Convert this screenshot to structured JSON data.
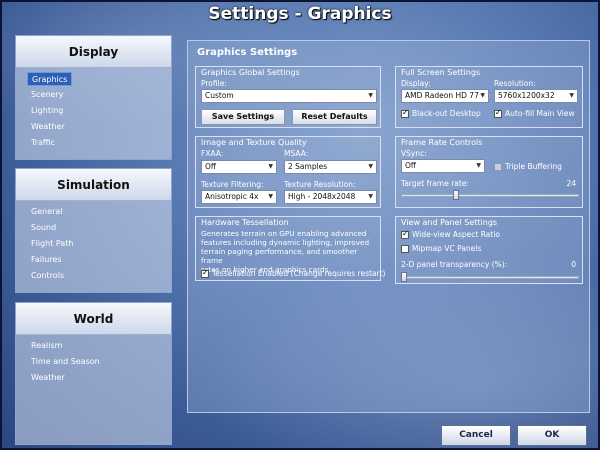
{
  "window": {
    "title": "Settings - Graphics"
  },
  "sidebar": {
    "display": {
      "title": "Display",
      "items": [
        "Graphics",
        "Scenery",
        "Lighting",
        "Weather",
        "Traffic"
      ]
    },
    "simulation": {
      "title": "Simulation",
      "items": [
        "General",
        "Sound",
        "Flight Path",
        "Failures",
        "Controls"
      ]
    },
    "world": {
      "title": "World",
      "items": [
        "Realism",
        "Time and Season",
        "Weather"
      ]
    }
  },
  "main": {
    "title": "Graphics Settings",
    "global": {
      "title": "Graphics Global Settings",
      "profile_label": "Profile:",
      "profile_value": "Custom",
      "save_label": "Save Settings",
      "reset_label": "Reset Defaults"
    },
    "fullscreen": {
      "title": "Full Screen Settings",
      "display_label": "Display:",
      "display_value": "AMD Radeon HD 77",
      "resolution_label": "Resolution:",
      "resolution_value": "5760x1200x32",
      "blackout_label": "Black-out Desktop",
      "blackout_checked": true,
      "autofill_label": "Auto-fill Main View",
      "autofill_checked": true
    },
    "image": {
      "title": "Image and Texture Quality",
      "fxaa_label": "FXAA:",
      "fxaa_value": "Off",
      "msaa_label": "MSAA:",
      "msaa_value": "2 Samples",
      "filtering_label": "Texture Filtering:",
      "filtering_value": "Anisotropic 4x",
      "resolution_label": "Texture Resolution:",
      "resolution_value": "High - 2048x2048"
    },
    "framerate": {
      "title": "Frame Rate Controls",
      "vsync_label": "VSync:",
      "vsync_value": "Off",
      "triple_label": "Triple Buffering",
      "triple_checked": false,
      "target_label": "Target frame rate:",
      "target_value": "24",
      "target_fraction": 0.3
    },
    "tessellation": {
      "title": "Hardware Tessellation",
      "description": [
        "Generates terrain on GPU enabling advanced",
        "features including dynamic lighting, improved",
        "terrain paging performance, and smoother frame",
        "rates on higher end graphics cards."
      ],
      "enabled_label": "Tessellation Enabled (Change requires restart)",
      "enabled_checked": true
    },
    "viewpanel": {
      "title": "View and Panel Settings",
      "wide_label": "Wide-view Aspect Ratio",
      "wide_checked": true,
      "mipmap_label": "Mipmap VC Panels",
      "mipmap_checked": false,
      "transparency_label": "2-D panel transparency (%):",
      "transparency_value": "0",
      "transparency_fraction": 0
    }
  },
  "footer": {
    "cancel_label": "Cancel",
    "ok_label": "OK"
  }
}
